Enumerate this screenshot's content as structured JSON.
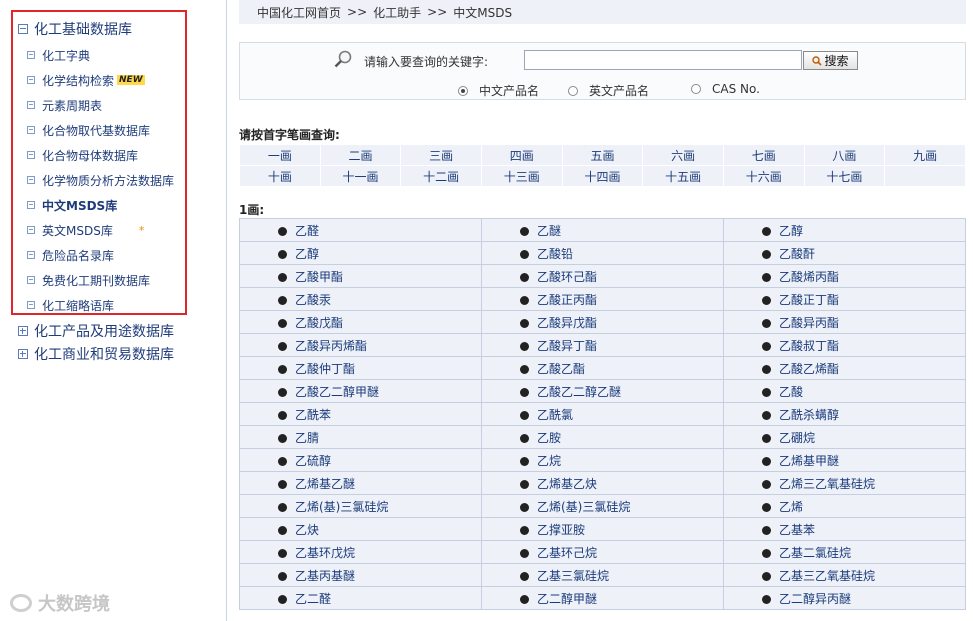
{
  "sidebar": {
    "section1": "化工基础数据库",
    "items": [
      {
        "label": "化工字典"
      },
      {
        "label": "化学结构检索",
        "badge": "NEW"
      },
      {
        "label": "元素周期表"
      },
      {
        "label": "化合物取代基数据库"
      },
      {
        "label": "化合物母体数据库"
      },
      {
        "label": "化学物质分析方法数据库"
      },
      {
        "label": "中文MSDS库"
      },
      {
        "label": "英文MSDS库",
        "mark": "*"
      },
      {
        "label": "危险品名录库"
      },
      {
        "label": "免费化工期刊数据库"
      },
      {
        "label": "化工缩略语库"
      }
    ],
    "section2": "化工产品及用途数据库",
    "section3": "化工商业和贸易数据库",
    "watermark": "大数跨境"
  },
  "breadcrumb": [
    "中国化工网首页",
    ">>",
    "化工助手",
    ">>",
    "中文MSDS"
  ],
  "search": {
    "label": "请输入要查询的关键字:",
    "value": "",
    "button": "搜索",
    "radios": [
      "中文产品名",
      "英文产品名",
      "CAS No."
    ],
    "selected": "中文产品名"
  },
  "strokes": {
    "title": "请按首字笔画查询:",
    "row1": [
      "一画",
      "二画",
      "三画",
      "四画",
      "五画",
      "六画",
      "七画",
      "八画",
      "九画"
    ],
    "row2": [
      "十画",
      "十一画",
      "十二画",
      "十三画",
      "十四画",
      "十五画",
      "十六画",
      "十七画",
      ""
    ]
  },
  "results": {
    "title": "1画:",
    "rows": [
      [
        "乙醛",
        "乙醚",
        "乙醇"
      ],
      [
        "乙醇",
        "乙酸铅",
        "乙酸酐"
      ],
      [
        "乙酸甲酯",
        "乙酸环己酯",
        "乙酸烯丙酯"
      ],
      [
        "乙酸汞",
        "乙酸正丙酯",
        "乙酸正丁酯"
      ],
      [
        "乙酸戊酯",
        "乙酸异戊酯",
        "乙酸异丙酯"
      ],
      [
        "乙酸异丙烯酯",
        "乙酸异丁酯",
        "乙酸叔丁酯"
      ],
      [
        "乙酸仲丁酯",
        "乙酸乙酯",
        "乙酸乙烯酯"
      ],
      [
        "乙酸乙二醇甲醚",
        "乙酸乙二醇乙醚",
        "乙酸"
      ],
      [
        "乙酰苯",
        "乙酰氯",
        "乙酰杀螨醇"
      ],
      [
        "乙腈",
        "乙胺",
        "乙硼烷"
      ],
      [
        "乙硫醇",
        "乙烷",
        "乙烯基甲醚"
      ],
      [
        "乙烯基乙醚",
        "乙烯基乙炔",
        "乙烯三乙氧基硅烷"
      ],
      [
        "乙烯(基)三氯硅烷",
        "乙烯(基)三氯硅烷",
        "乙烯"
      ],
      [
        "乙炔",
        "乙撑亚胺",
        "乙基苯"
      ],
      [
        "乙基环戊烷",
        "乙基环己烷",
        "乙基二氯硅烷"
      ],
      [
        "乙基丙基醚",
        "乙基三氯硅烷",
        "乙基三乙氧基硅烷"
      ],
      [
        "乙二醛",
        "乙二醇甲醚",
        "乙二醇异丙醚"
      ]
    ]
  }
}
